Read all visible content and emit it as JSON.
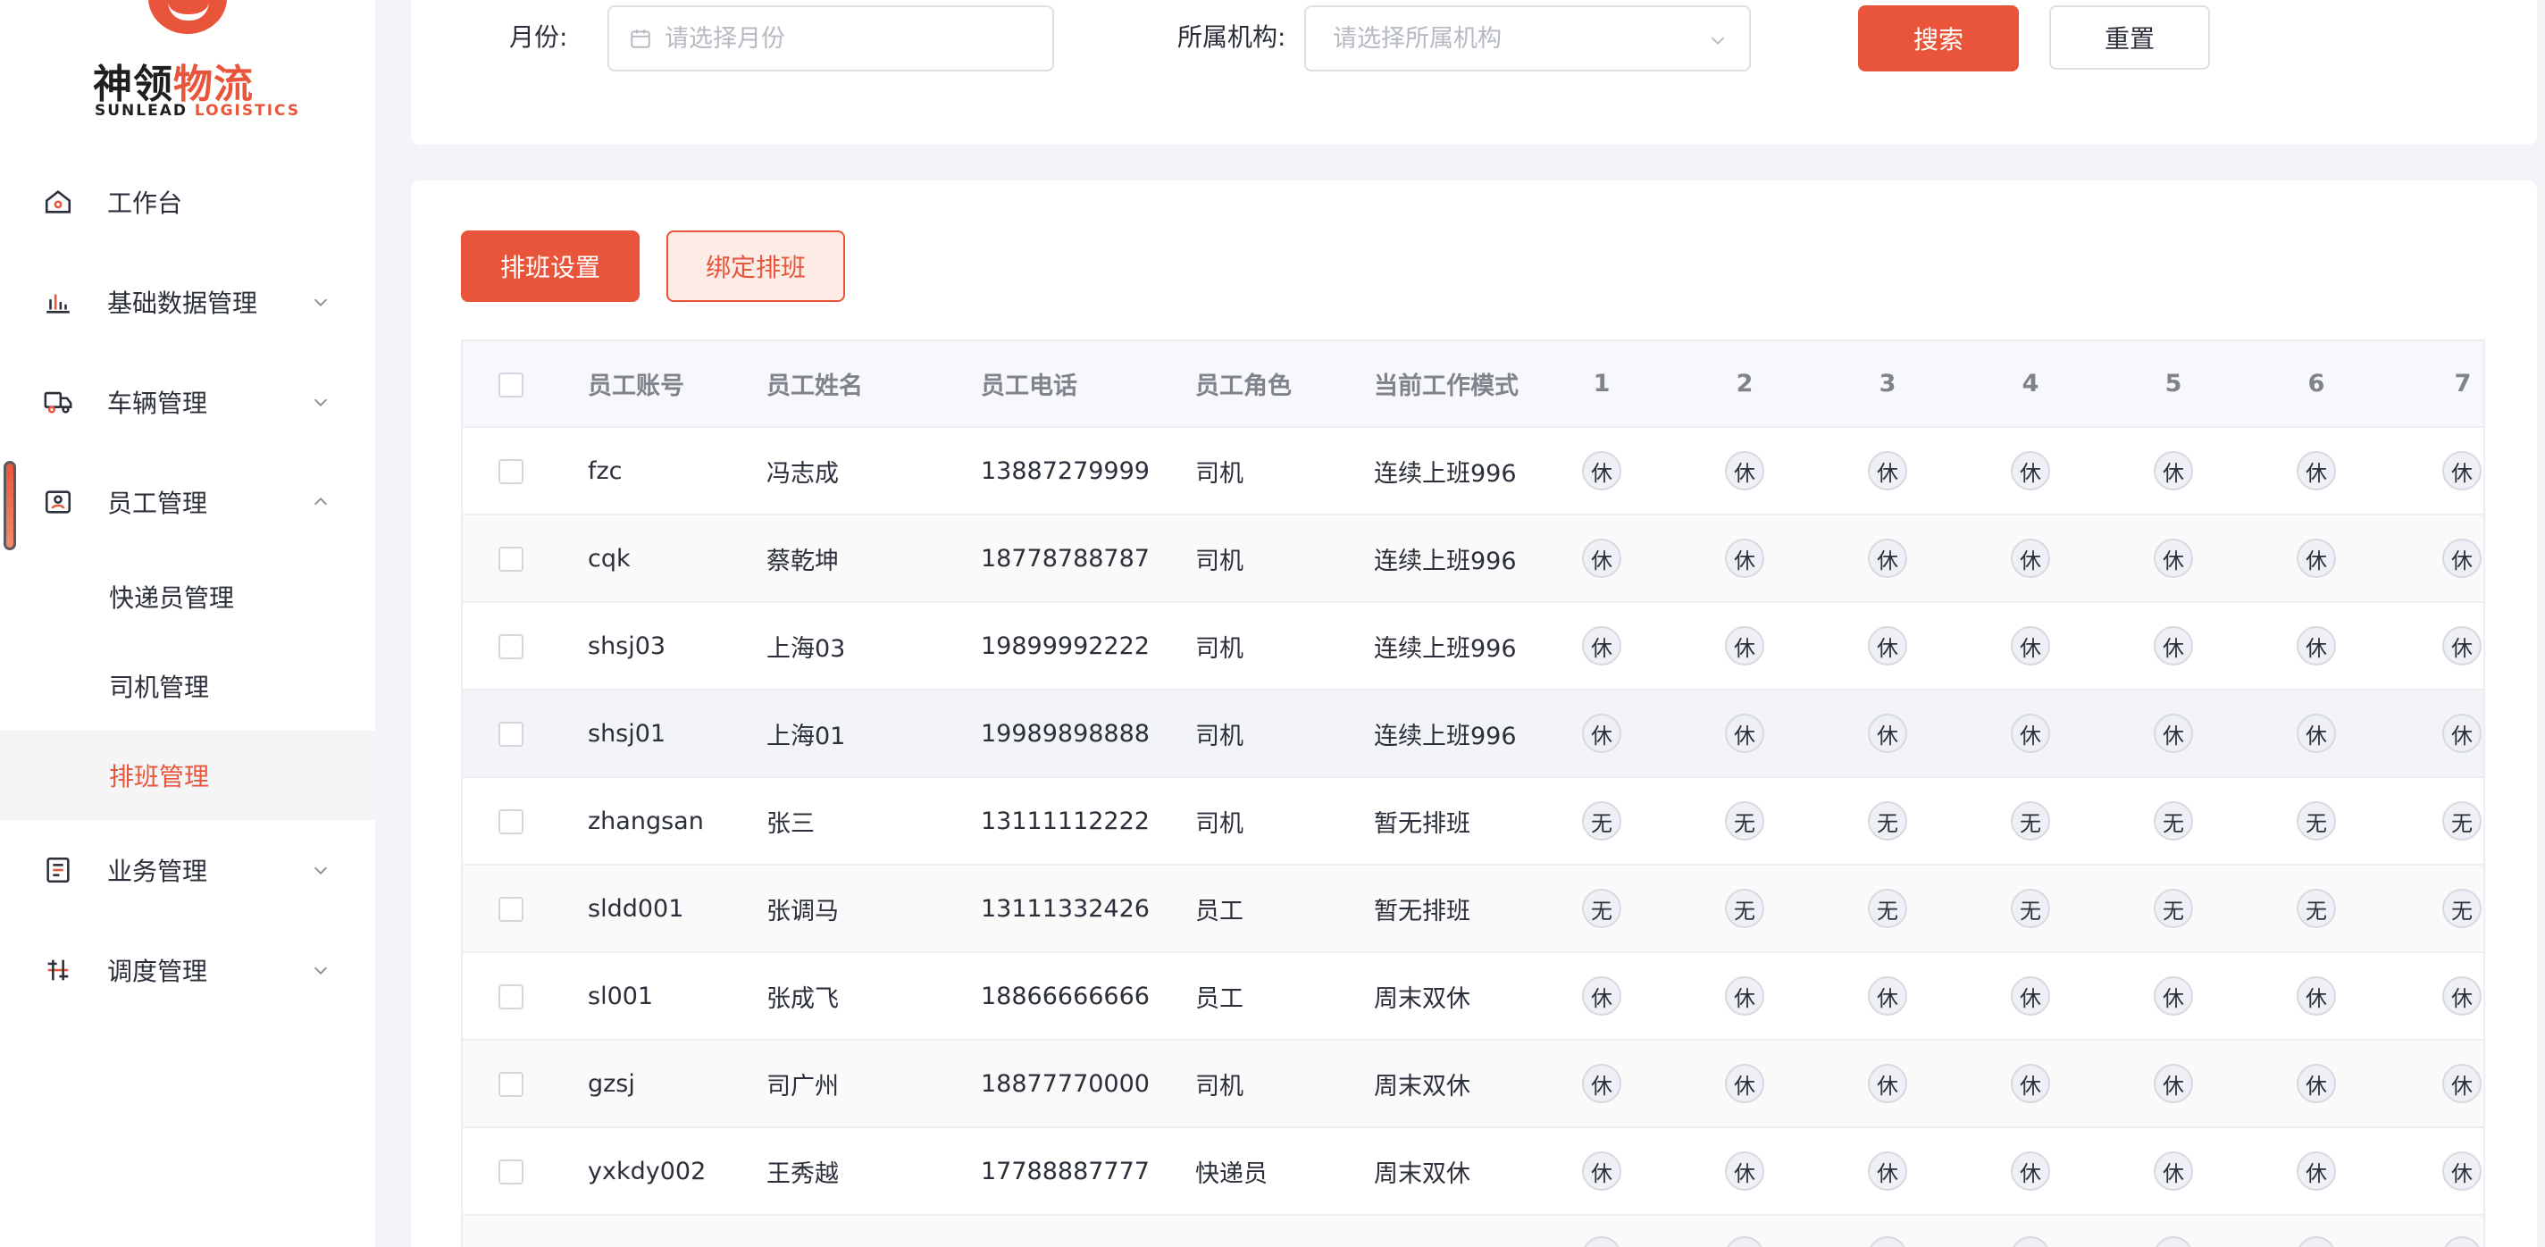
{
  "brand": {
    "cn_part1": "神领",
    "cn_part2": "物流",
    "en_part1": "SUNLEAD",
    "en_part2": "LOGISTICS",
    "accent_color": "#e8553a"
  },
  "sidebar": {
    "items": [
      {
        "label": "工作台",
        "icon": "home-icon"
      },
      {
        "label": "基础数据管理",
        "icon": "bar-chart-icon"
      },
      {
        "label": "车辆管理",
        "icon": "truck-icon"
      },
      {
        "label": "员工管理",
        "icon": "employee-badge-icon"
      },
      {
        "label": "业务管理",
        "icon": "business-icon"
      },
      {
        "label": "调度管理",
        "icon": "dispatch-icon"
      }
    ],
    "submenu": [
      {
        "label": "快递员管理"
      },
      {
        "label": "司机管理"
      },
      {
        "label": "排班管理"
      }
    ]
  },
  "search": {
    "month_label": "月份:",
    "month_placeholder": "请选择月份",
    "org_label": "所属机构:",
    "org_placeholder": "请选择所属机构",
    "search_button": "搜索",
    "reset_button": "重置"
  },
  "toolbar": {
    "schedule_settings": "排班设置",
    "bind_schedule": "绑定排班"
  },
  "table": {
    "headers": {
      "account": "员工账号",
      "name": "员工姓名",
      "phone": "员工电话",
      "role": "员工角色",
      "mode": "当前工作模式",
      "days": [
        "1",
        "2",
        "3",
        "4",
        "5",
        "6",
        "7"
      ]
    },
    "rows": [
      {
        "account": "fzc",
        "name": "冯志成",
        "phone": "13887279999",
        "role": "司机",
        "mode": "连续上班996",
        "days": [
          "休",
          "休",
          "休",
          "休",
          "休",
          "休",
          "休"
        ]
      },
      {
        "account": "cqk",
        "name": "蔡乾坤",
        "phone": "18778788787",
        "role": "司机",
        "mode": "连续上班996",
        "days": [
          "休",
          "休",
          "休",
          "休",
          "休",
          "休",
          "休"
        ]
      },
      {
        "account": "shsj03",
        "name": "上海03",
        "phone": "19899992222",
        "role": "司机",
        "mode": "连续上班996",
        "days": [
          "休",
          "休",
          "休",
          "休",
          "休",
          "休",
          "休"
        ]
      },
      {
        "account": "shsj01",
        "name": "上海01",
        "phone": "19989898888",
        "role": "司机",
        "mode": "连续上班996",
        "days": [
          "休",
          "休",
          "休",
          "休",
          "休",
          "休",
          "休"
        ]
      },
      {
        "account": "zhangsan",
        "name": "张三",
        "phone": "13111112222",
        "role": "司机",
        "mode": "暂无排班",
        "days": [
          "无",
          "无",
          "无",
          "无",
          "无",
          "无",
          "无"
        ]
      },
      {
        "account": "sldd001",
        "name": "张调马",
        "phone": "13111332426",
        "role": "员工",
        "mode": "暂无排班",
        "days": [
          "无",
          "无",
          "无",
          "无",
          "无",
          "无",
          "无"
        ]
      },
      {
        "account": "sl001",
        "name": "张成飞",
        "phone": "18866666666",
        "role": "员工",
        "mode": "周末双休",
        "days": [
          "休",
          "休",
          "休",
          "休",
          "休",
          "休",
          "休"
        ]
      },
      {
        "account": "gzsj",
        "name": "司广州",
        "phone": "18877770000",
        "role": "司机",
        "mode": "周末双休",
        "days": [
          "休",
          "休",
          "休",
          "休",
          "休",
          "休",
          "休"
        ]
      },
      {
        "account": "yxkdy002",
        "name": "王秀越",
        "phone": "17788887777",
        "role": "快递员",
        "mode": "周末双休",
        "days": [
          "休",
          "休",
          "休",
          "休",
          "休",
          "休",
          "休"
        ]
      },
      {
        "account": "",
        "name": "",
        "phone": "",
        "role": "",
        "mode": "",
        "days": [
          "",
          "",
          "",
          "",
          "",
          "",
          ""
        ]
      }
    ]
  }
}
